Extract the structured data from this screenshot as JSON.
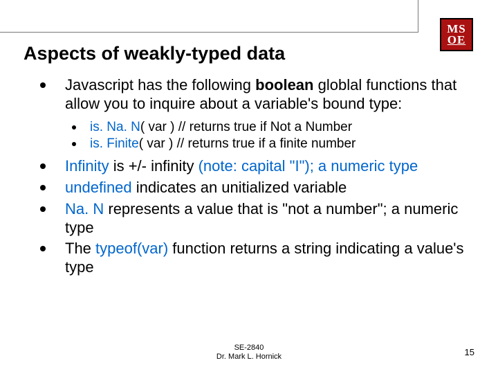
{
  "logo": {
    "line1": "MS",
    "line2": "OE"
  },
  "title": "Aspects of weakly-typed data",
  "bullets": {
    "b1": {
      "pre": "Javascript has the following ",
      "bold": "boolean",
      "post": " globlal functions that allow you to inquire about a variable's bound type:"
    },
    "sub1": {
      "fn": "is. Na. N",
      "rest": "( var )  // returns true if Not a Number"
    },
    "sub2": {
      "fn": "is. Finite",
      "rest": "( var ) // returns true if a finite number"
    },
    "b2": {
      "kw": "Infinity",
      "mid": " is +/- infinity ",
      "note": "(note: capital \"I\"); a numeric type"
    },
    "b3": {
      "kw": "undefined",
      "rest": " indicates an unitialized variable"
    },
    "b4": {
      "kw": "Na. N",
      "rest": " represents a value that is \"not a number\"; a numeric type"
    },
    "b5": {
      "pre": "The ",
      "fn": "typeof(var)",
      "post": " function returns a string indicating a value's type"
    }
  },
  "footer": {
    "course": "SE-2840",
    "author": "Dr. Mark L. Hornick"
  },
  "page": "15"
}
